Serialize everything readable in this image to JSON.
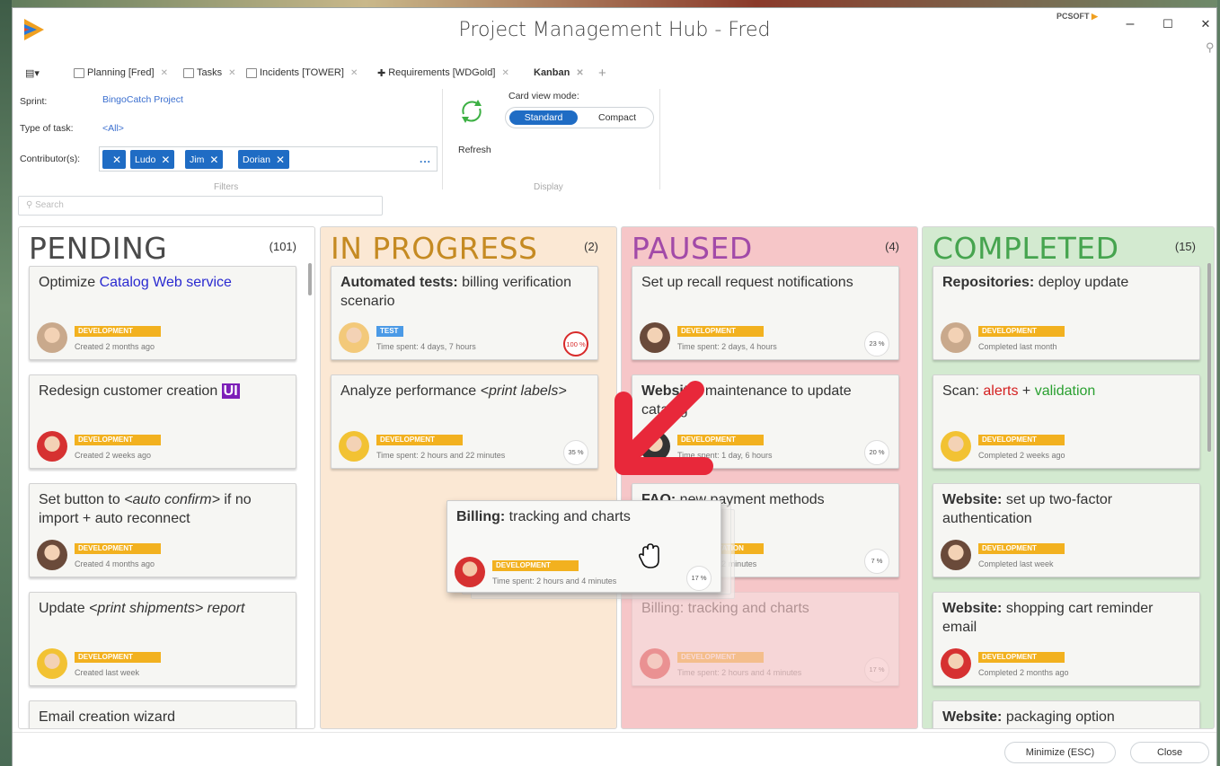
{
  "window": {
    "title": "Project Management Hub - Fred",
    "vendor": "PCSOFT",
    "minimize_glyph": "–",
    "maximize_glyph": "☐",
    "close_glyph": "✕"
  },
  "tabs": [
    {
      "label": "Planning [Fred]",
      "icon": "calendar-icon"
    },
    {
      "label": "Tasks",
      "icon": "document-icon"
    },
    {
      "label": "Incidents [TOWER]",
      "icon": "incident-icon"
    },
    {
      "label": "Requirements [WDGold]",
      "icon": "link-icon"
    },
    {
      "label": "Kanban",
      "icon": "",
      "active": true
    }
  ],
  "filters": {
    "sprint_label": "Sprint:",
    "sprint_value": "BingoCatch Project",
    "type_label": "Type of task:",
    "type_value": "<All>",
    "contrib_label": "Contributor(s):",
    "chips": [
      "",
      "Ludo",
      "Jim",
      "Dorian"
    ],
    "more": "...",
    "group_label": "Filters"
  },
  "display": {
    "refresh_label": "Refresh",
    "card_view_label": "Card view mode:",
    "mode_standard": "Standard",
    "mode_compact": "Compact",
    "group_label": "Display"
  },
  "search": {
    "placeholder": "Search"
  },
  "columns": [
    {
      "title": "PENDING",
      "count": "(101)",
      "cards": [
        {
          "title_html": "Optimize <span class=\"blue\">Catalog Web service</span>",
          "tag": "DEVELOPMENT",
          "sub": "Created 2 months ago",
          "avatar": "#c9a98c"
        },
        {
          "title_html": "Redesign customer creation <span class=\"ui\">UI</span>",
          "tag": "DEVELOPMENT",
          "sub": "Created 2 weeks ago",
          "avatar": "#d63131"
        },
        {
          "title_html": "Set button to <i>&lt;auto confirm&gt;</i> if no import + auto reconnect",
          "tag": "DEVELOPMENT",
          "sub": "Created 4 months ago",
          "avatar": "#6a4a3a"
        },
        {
          "title_html": "Update <i>&lt;print shipments&gt; report</i>",
          "tag": "DEVELOPMENT",
          "sub": "Created last week",
          "avatar": "#f2c233"
        },
        {
          "title_html": "Email creation wizard",
          "tag": "",
          "sub": "",
          "avatar": ""
        }
      ]
    },
    {
      "title": "IN PROGRESS",
      "count": "(2)",
      "cards": [
        {
          "title_html": "<span class=\"bold\">Automated tests:</span> billing verification scenario",
          "tag": "TEST",
          "sub": "Time spent: 4 days, 7 hours",
          "gauge": "100 %",
          "avatar": "#f3c97a"
        },
        {
          "title_html": "Analyze performance <i>&lt;print labels&gt;</i>",
          "tag": "DEVELOPMENT",
          "sub": "Time spent: 2 hours and 22 minutes",
          "gauge": "35 %",
          "avatar": "#f2c233"
        }
      ]
    },
    {
      "title": "PAUSED",
      "count": "(4)",
      "cards": [
        {
          "title_html": "Set up recall request notifications",
          "tag": "DEVELOPMENT",
          "sub": "Time spent: 2 days, 4 hours",
          "gauge": "23 %",
          "avatar": "#6a4a3a"
        },
        {
          "title_html": "<span class=\"bold\">Website:</span> maintenance to update catalog",
          "tag": "DEVELOPMENT",
          "sub": "Time spent: 1 day, 6 hours",
          "gauge": "20 %",
          "avatar": "#333333"
        },
        {
          "title_html": "<span class=\"bold\">FAQ:</span> new payment methods",
          "tag": "DOCUMENTATION",
          "sub": "Time spent: 2 minutes",
          "gauge": "7 %",
          "avatar": "#c9a98c"
        },
        {
          "title_html": "Billing: tracking and charts",
          "tag": "DEVELOPMENT",
          "sub": "Time spent: 2 hours and 4 minutes",
          "gauge": "17 %",
          "avatar": "#d63131",
          "ghost": true
        }
      ]
    },
    {
      "title": "COMPLETED",
      "count": "(15)",
      "cards": [
        {
          "title_html": "<span class=\"bold\">Repositories:</span> deploy update",
          "tag": "DEVELOPMENT",
          "sub": "Completed last month",
          "avatar": "#c9a98c"
        },
        {
          "title_html": "Scan: <span class=\"red\">alerts</span> + <span class=\"green\">validation</span>",
          "tag": "DEVELOPMENT",
          "sub": "Completed 2 weeks ago",
          "avatar": "#f2c233"
        },
        {
          "title_html": "<span class=\"bold\">Website:</span> set up two-factor authentication",
          "tag": "DEVELOPMENT",
          "sub": "Completed last week",
          "avatar": "#6a4a3a"
        },
        {
          "title_html": "<span class=\"bold\">Website:</span> shopping cart reminder email",
          "tag": "DEVELOPMENT",
          "sub": "Completed 2 months ago",
          "avatar": "#d63131"
        },
        {
          "title_html": "<span class=\"bold\">Website:</span> packaging option",
          "tag": "",
          "sub": "",
          "avatar": ""
        }
      ]
    }
  ],
  "dragged_card": {
    "title_bold": "Billing:",
    "title_rest": " tracking and charts",
    "tag": "DEVELOPMENT",
    "sub": "Time spent: 2 hours and 4 minutes",
    "gauge": "17 %"
  },
  "footer": {
    "minimize_label": "Minimize (ESC)",
    "close_label": "Close"
  },
  "colors": {
    "accent": "#1f6cc4",
    "pending": "#ffffff",
    "in_progress": "#fbe8d4",
    "paused": "#f6c6c8",
    "completed": "#d3ead0",
    "tag_development": "#f2b11f",
    "tag_test": "#4b9ae6",
    "arrow": "#e8283a"
  }
}
